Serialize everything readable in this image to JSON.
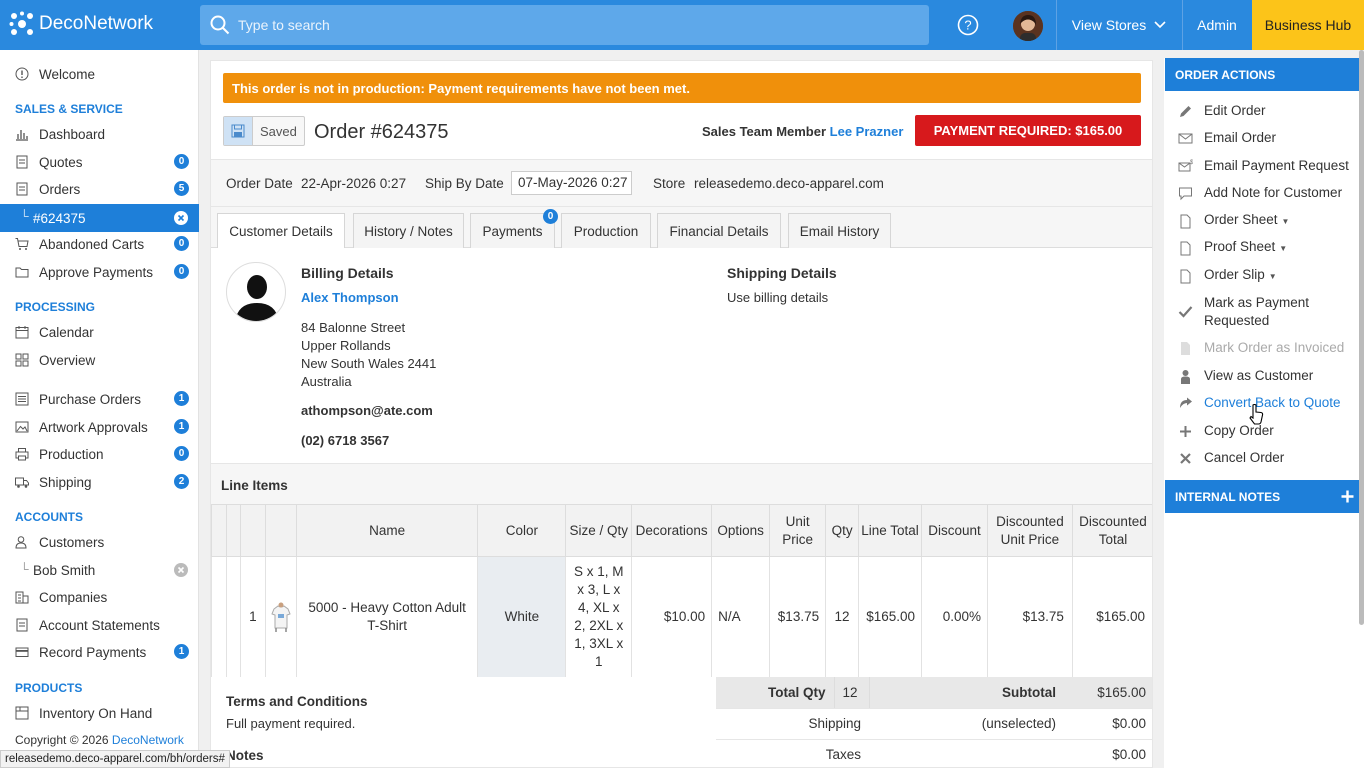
{
  "topbar": {
    "logo_text": "DecoNetwork",
    "search_placeholder": "Type to search",
    "view_stores": "View Stores",
    "admin": "Admin",
    "business_hub": "Business Hub"
  },
  "sidebar": {
    "welcome": "Welcome",
    "sections": {
      "sales": "SALES & SERVICE",
      "processing": "PROCESSING",
      "accounts": "ACCOUNTS",
      "products": "PRODUCTS"
    },
    "items": {
      "dashboard": "Dashboard",
      "quotes": {
        "label": "Quotes",
        "count": "0"
      },
      "orders": {
        "label": "Orders",
        "count": "5"
      },
      "current_order": "#624375",
      "abandoned_carts": {
        "label": "Abandoned Carts",
        "count": "0"
      },
      "approve_payments": {
        "label": "Approve Payments",
        "count": "0"
      },
      "calendar": "Calendar",
      "overview": "Overview",
      "purchase_orders": {
        "label": "Purchase Orders",
        "count": "1"
      },
      "artwork_approvals": {
        "label": "Artwork Approvals",
        "count": "1"
      },
      "production": {
        "label": "Production",
        "count": "0"
      },
      "shipping": {
        "label": "Shipping",
        "count": "2"
      },
      "customers": "Customers",
      "bob_smith": "Bob Smith",
      "companies": "Companies",
      "account_statements": "Account Statements",
      "record_payments": {
        "label": "Record Payments",
        "count": "1"
      },
      "inventory_on_hand": "Inventory On Hand"
    },
    "copyright_prefix": "Copyright © 2026 ",
    "copyright_link": "DecoNetwork"
  },
  "status_bar_url": "releasedemo.deco-apparel.com/bh/orders#",
  "order": {
    "warning": "This order is not in production: Payment requirements have not been met.",
    "saved_label": "Saved",
    "title": "Order #624375",
    "sales_team_label": "Sales Team Member",
    "sales_team_member": "Lee Prazner",
    "payment_required": "PAYMENT REQUIRED: $165.00",
    "order_date_label": "Order Date",
    "order_date": "22-Apr-2026 0:27",
    "ship_by_label": "Ship By Date",
    "ship_by": "07-May-2026 0:27",
    "store_label": "Store",
    "store": "releasedemo.deco-apparel.com"
  },
  "tabs": [
    {
      "label": "Customer Details"
    },
    {
      "label": "History / Notes"
    },
    {
      "label": "Payments",
      "badge": "0"
    },
    {
      "label": "Production"
    },
    {
      "label": "Financial Details"
    },
    {
      "label": "Email History"
    }
  ],
  "customer": {
    "billing_heading": "Billing Details",
    "name": "Alex Thompson",
    "address": [
      "84 Balonne Street",
      "Upper Rollands",
      "New South Wales 2441",
      "Australia"
    ],
    "email": "athompson@ate.com",
    "phone": "(02) 6718 3567",
    "shipping_heading": "Shipping Details",
    "shipping_text": "Use billing details"
  },
  "line_items": {
    "heading": "Line Items",
    "columns": [
      "Name",
      "Color",
      "Size / Qty",
      "Decorations",
      "Options",
      "Unit Price",
      "Qty",
      "Line Total",
      "Discount",
      "Discounted Unit Price",
      "Discounted Total"
    ],
    "rows": [
      {
        "num": "1",
        "name": "5000 - Heavy Cotton Adult T-Shirt",
        "color": "White",
        "size_qty": "S x 1, M x 3, L x 4, XL x 2, 2XL x 1, 3XL x 1",
        "decorations": "$10.00",
        "options": "N/A",
        "unit_price": "$13.75",
        "qty": "12",
        "line_total": "$165.00",
        "discount": "0.00%",
        "disc_unit_price": "$13.75",
        "disc_total": "$165.00"
      }
    ]
  },
  "terms": {
    "heading": "Terms and Conditions",
    "text": "Full payment required.",
    "notes_heading": "Notes"
  },
  "totals": {
    "total_qty_label": "Total Qty",
    "total_qty": "12",
    "subtotal_label": "Subtotal",
    "subtotal": "$165.00",
    "shipping_label": "Shipping",
    "shipping_note": "(unselected)",
    "shipping": "$0.00",
    "taxes_label": "Taxes",
    "taxes": "$0.00"
  },
  "order_actions": {
    "heading": "ORDER ACTIONS",
    "items": {
      "edit": "Edit Order",
      "email": "Email Order",
      "email_payment": "Email Payment Request",
      "add_note": "Add Note for Customer",
      "order_sheet": "Order Sheet",
      "proof_sheet": "Proof Sheet",
      "order_slip": "Order Slip",
      "mark_payment": "Mark as Payment Requested",
      "mark_invoiced": "Mark Order as Invoiced",
      "view_customer": "View as Customer",
      "convert_quote": "Convert Back to Quote",
      "copy": "Copy Order",
      "cancel": "Cancel Order"
    }
  },
  "internal_notes": {
    "heading": "INTERNAL NOTES"
  },
  "colors": {
    "accent": "#1e7fd9",
    "warning": "#f0900b",
    "danger": "#d7191c",
    "business_hub": "#fcc419"
  }
}
